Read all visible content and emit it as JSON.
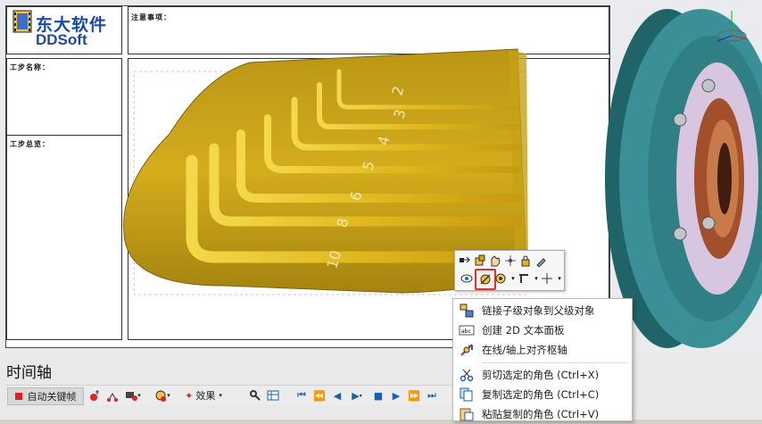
{
  "logo": {
    "cn": "东大软件",
    "en": "DDSoft"
  },
  "sheet": {
    "notes_label": "注意事项：",
    "step_name_label": "工步名称：",
    "step_overview_label": "工步总览："
  },
  "model_numbers": [
    "2",
    "3",
    "4",
    "5",
    "6",
    "8",
    "10"
  ],
  "timeline": {
    "title": "时间轴",
    "auto_key_label": "自动关键帧",
    "effects_label": "效果"
  },
  "context_menu": {
    "items": [
      {
        "label": "链接子级对象到父级对象",
        "icon": "link-icon"
      },
      {
        "label": "创建 2D 文本面板",
        "icon": "text-panel-icon"
      },
      {
        "label": "在线/轴上对齐枢轴",
        "icon": "align-pivot-icon"
      },
      {
        "label": "剪切选定的角色 (Ctrl+X)",
        "icon": "scissors-icon"
      },
      {
        "label": "复制选定的角色 (Ctrl+C)",
        "icon": "copy-icon"
      },
      {
        "label": "粘贴复制的角色 (Ctrl+V)",
        "icon": "paste-icon"
      }
    ]
  },
  "colors": {
    "accent": "#e03030",
    "model_gold": "#d9b21c",
    "part_teal": "#2f7f84"
  }
}
